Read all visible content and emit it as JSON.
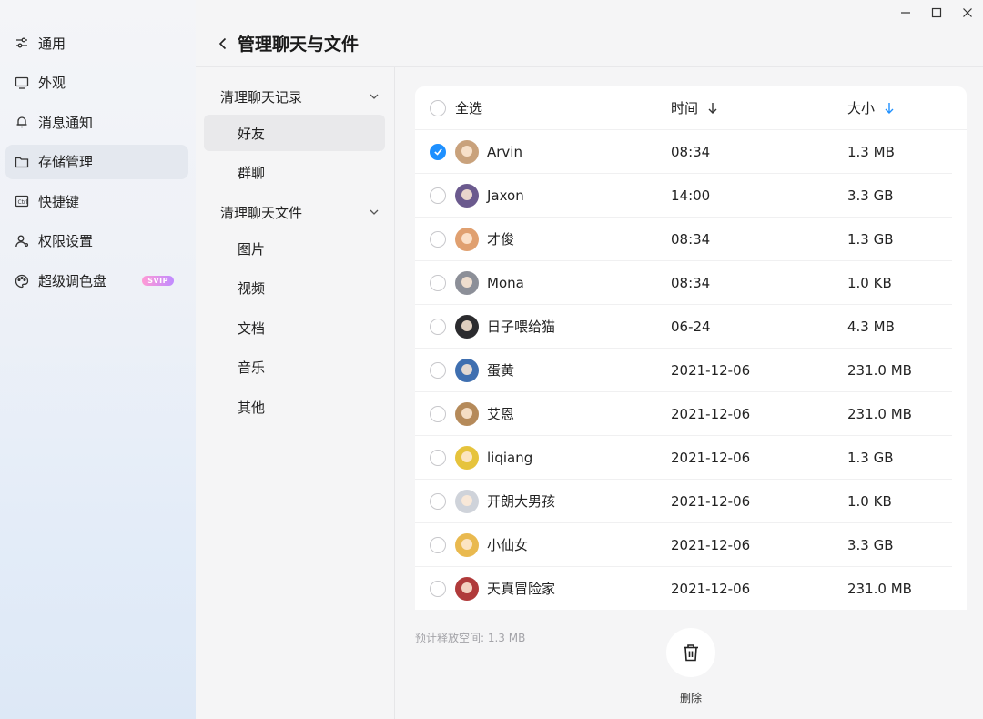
{
  "sidebar": {
    "items": [
      {
        "label": "通用",
        "icon": "sliders-icon"
      },
      {
        "label": "外观",
        "icon": "monitor-icon"
      },
      {
        "label": "消息通知",
        "icon": "bell-icon"
      },
      {
        "label": "存储管理",
        "icon": "folder-icon",
        "active": true
      },
      {
        "label": "快捷键",
        "icon": "keyboard-icon"
      },
      {
        "label": "权限设置",
        "icon": "user-permission-icon"
      },
      {
        "label": "超级调色盘",
        "icon": "palette-icon",
        "badge": "SVIP"
      }
    ]
  },
  "header": {
    "title": "管理聊天与文件"
  },
  "subnav": {
    "group1": {
      "label": "清理聊天记录",
      "items": [
        "好友",
        "群聊"
      ]
    },
    "group2": {
      "label": "清理聊天文件",
      "items": [
        "图片",
        "视频",
        "文档",
        "音乐",
        "其他"
      ]
    }
  },
  "table": {
    "headers": {
      "select_all": "全选",
      "time": "时间",
      "size": "大小"
    },
    "rows": [
      {
        "name": "Arvin",
        "time": "08:34",
        "size": "1.3 MB",
        "checked": true,
        "color": "#c9a27c"
      },
      {
        "name": "Jaxon",
        "time": "14:00",
        "size": "3.3 GB",
        "checked": false,
        "color": "#6b5a8e"
      },
      {
        "name": "才俊",
        "time": "08:34",
        "size": "1.3 GB",
        "checked": false,
        "color": "#e0a070"
      },
      {
        "name": "Mona",
        "time": "08:34",
        "size": "1.0 KB",
        "checked": false,
        "color": "#8c8f98"
      },
      {
        "name": "日子喂给猫",
        "time": "06-24",
        "size": "4.3 MB",
        "checked": false,
        "color": "#2b2b2e"
      },
      {
        "name": "蛋黄",
        "time": "2021-12-06",
        "size": "231.0 MB",
        "checked": false,
        "color": "#3f6fb0"
      },
      {
        "name": "艾恩",
        "time": "2021-12-06",
        "size": "231.0 MB",
        "checked": false,
        "color": "#b58a5a"
      },
      {
        "name": "liqiang",
        "time": "2021-12-06",
        "size": "1.3 GB",
        "checked": false,
        "color": "#e6c33c"
      },
      {
        "name": "开朗大男孩",
        "time": "2021-12-06",
        "size": "1.0 KB",
        "checked": false,
        "color": "#cfd3da"
      },
      {
        "name": "小仙女",
        "time": "2021-12-06",
        "size": "3.3 GB",
        "checked": false,
        "color": "#e9b94f"
      },
      {
        "name": "天真冒险家",
        "time": "2021-12-06",
        "size": "231.0 MB",
        "checked": false,
        "color": "#b03a3a"
      }
    ]
  },
  "footer": {
    "release_space": "预计释放空间: 1.3 MB",
    "delete_label": "删除"
  },
  "colors": {
    "accent": "#1e90ff",
    "svip_start": "#ff9ad5",
    "svip_end": "#c08bff"
  }
}
